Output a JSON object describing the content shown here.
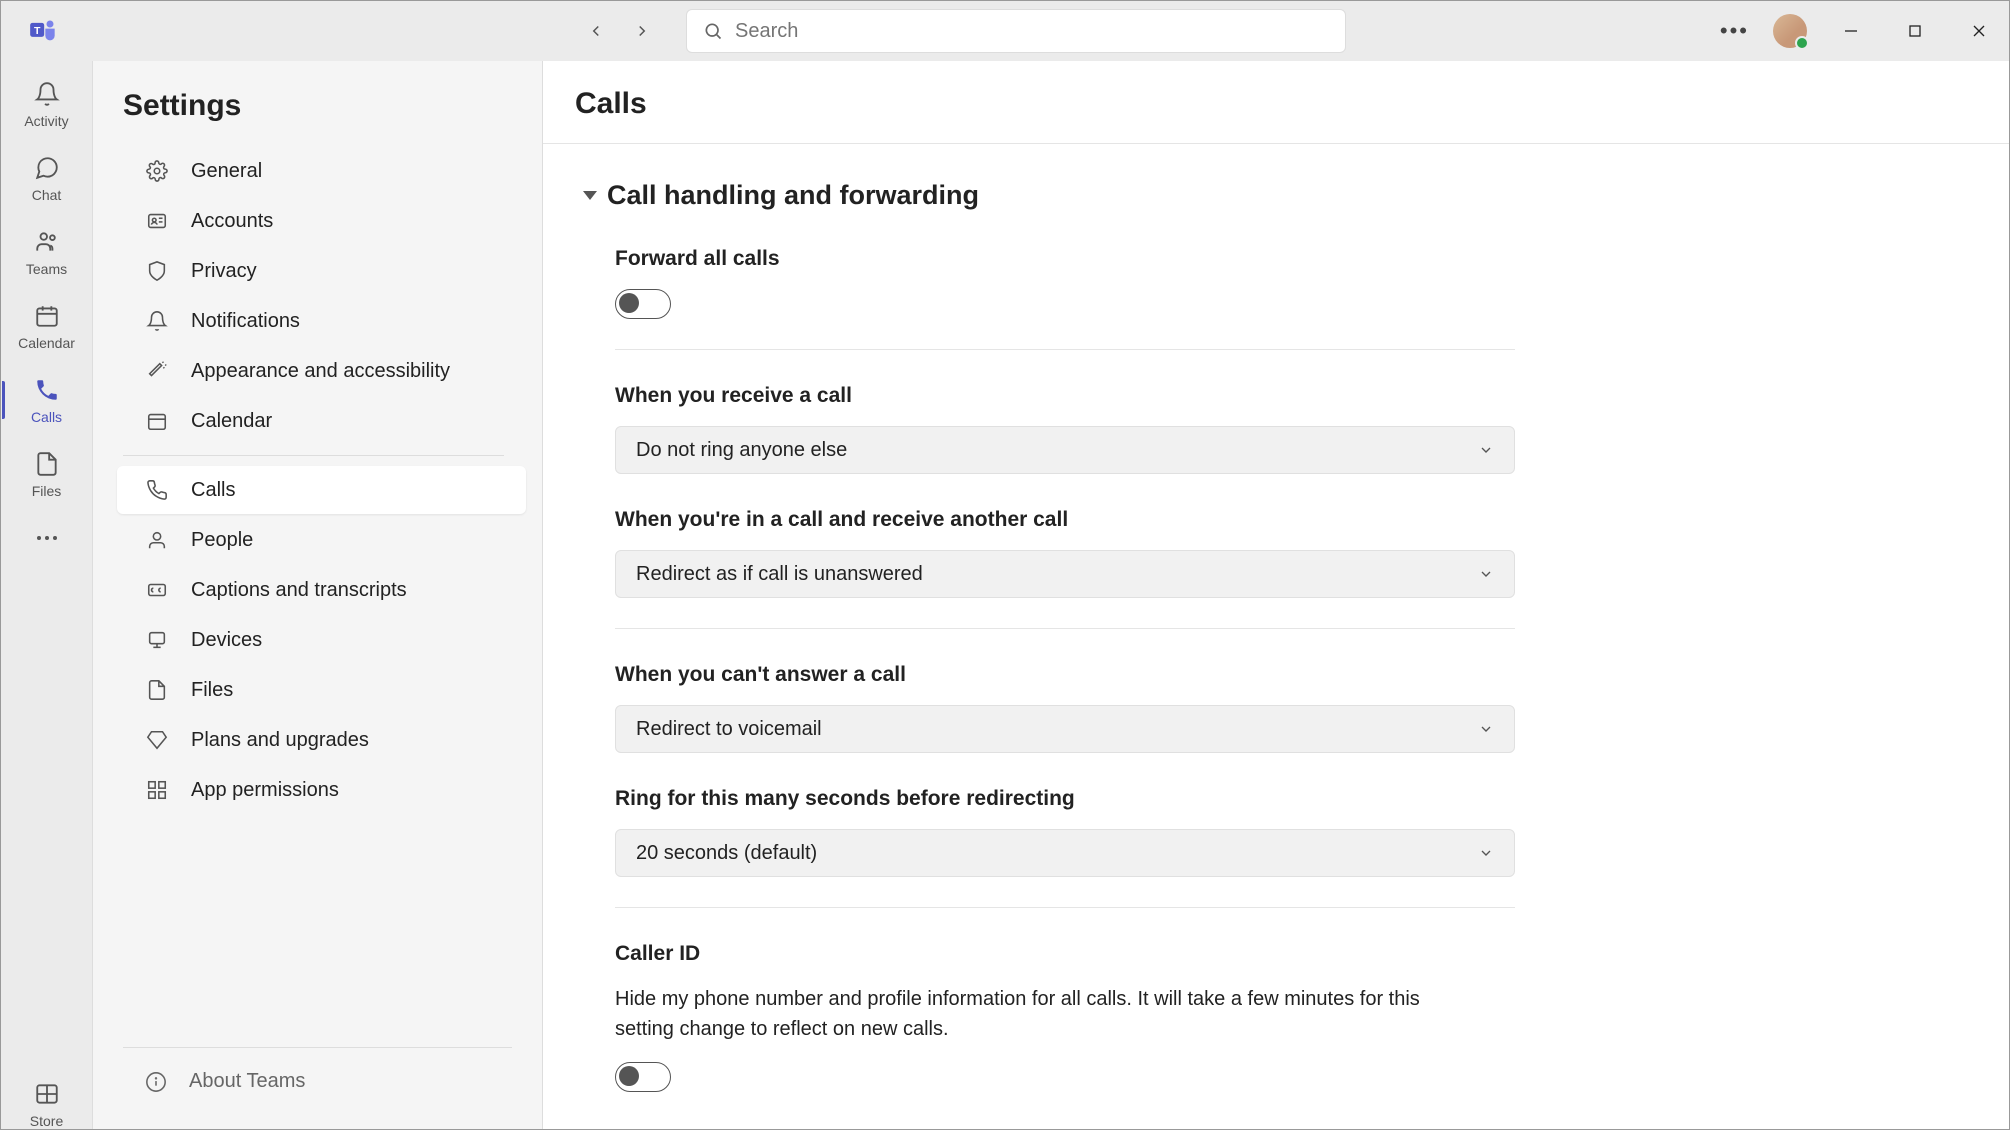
{
  "titlebar": {
    "search_placeholder": "Search"
  },
  "rail": {
    "items": [
      {
        "label": "Activity"
      },
      {
        "label": "Chat"
      },
      {
        "label": "Teams"
      },
      {
        "label": "Calendar"
      },
      {
        "label": "Calls"
      },
      {
        "label": "Files"
      }
    ],
    "store_label": "Store"
  },
  "sidebar": {
    "title": "Settings",
    "items": [
      {
        "label": "General"
      },
      {
        "label": "Accounts"
      },
      {
        "label": "Privacy"
      },
      {
        "label": "Notifications"
      },
      {
        "label": "Appearance and accessibility"
      },
      {
        "label": "Calendar"
      },
      {
        "label": "Calls"
      },
      {
        "label": "People"
      },
      {
        "label": "Captions and transcripts"
      },
      {
        "label": "Devices"
      },
      {
        "label": "Files"
      },
      {
        "label": "Plans and upgrades"
      },
      {
        "label": "App permissions"
      }
    ],
    "about_label": "About Teams"
  },
  "content": {
    "title": "Calls",
    "section_title": "Call handling and forwarding",
    "forward_all_label": "Forward all calls",
    "forward_all_on": false,
    "receive_label": "When you receive a call",
    "receive_value": "Do not ring anyone else",
    "in_call_label": "When you're in a call and receive another call",
    "in_call_value": "Redirect as if call is unanswered",
    "cant_answer_label": "When you can't answer a call",
    "cant_answer_value": "Redirect to voicemail",
    "ring_label": "Ring for this many seconds before redirecting",
    "ring_value": "20 seconds (default)",
    "caller_id_label": "Caller ID",
    "caller_id_desc": "Hide my phone number and profile information for all calls. It will take a few minutes for this setting change to reflect on new calls.",
    "caller_id_on": false
  }
}
